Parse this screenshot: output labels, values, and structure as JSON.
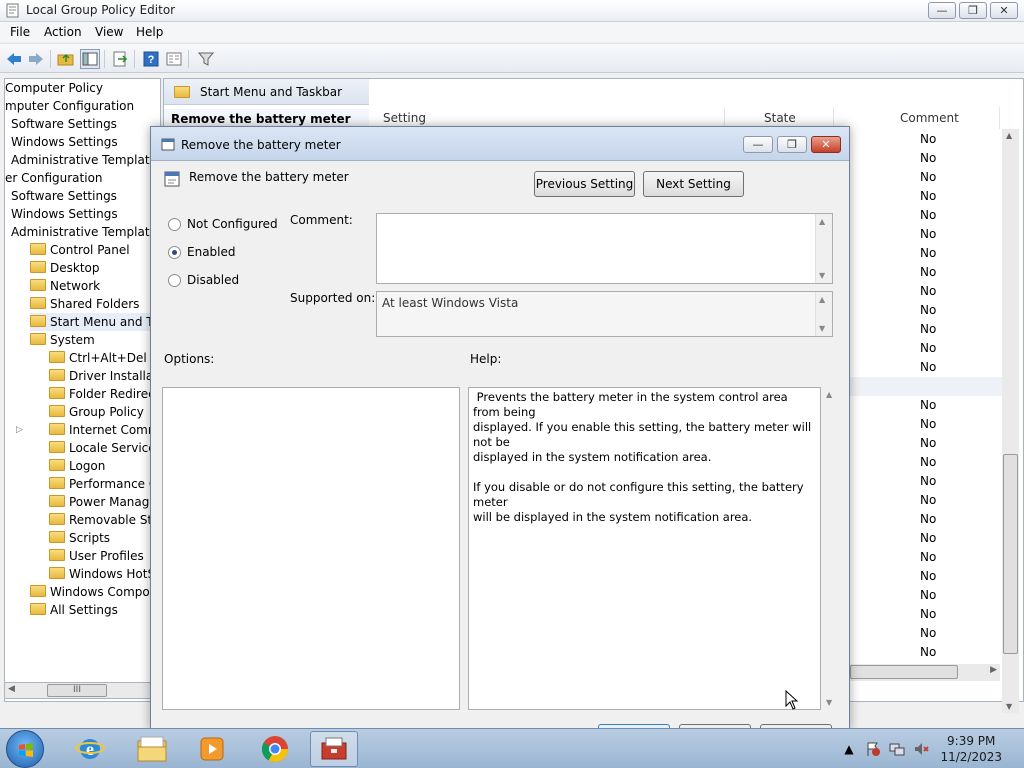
{
  "window": {
    "title": "Local Group Policy Editor",
    "min": "—",
    "max": "❐",
    "close": "✕"
  },
  "menu": [
    "File",
    "Action",
    "View",
    "Help"
  ],
  "tree": {
    "items": [
      {
        "label": "Computer Policy",
        "indent": 0,
        "folder": false
      },
      {
        "label": "mputer Configuration",
        "indent": 0,
        "folder": false
      },
      {
        "label": "Software Settings",
        "indent": 1,
        "folder": false
      },
      {
        "label": "Windows Settings",
        "indent": 1,
        "folder": false
      },
      {
        "label": "Administrative Templates",
        "indent": 1,
        "folder": false
      },
      {
        "label": "er Configuration",
        "indent": 0,
        "folder": false
      },
      {
        "label": "Software Settings",
        "indent": 1,
        "folder": false
      },
      {
        "label": "Windows Settings",
        "indent": 1,
        "folder": false
      },
      {
        "label": "Administrative Templates",
        "indent": 1,
        "folder": false
      },
      {
        "label": "Control Panel",
        "indent": 2,
        "folder": true
      },
      {
        "label": "Desktop",
        "indent": 2,
        "folder": true
      },
      {
        "label": "Network",
        "indent": 2,
        "folder": true
      },
      {
        "label": "Shared Folders",
        "indent": 2,
        "folder": true
      },
      {
        "label": "Start Menu and Taskba",
        "indent": 2,
        "folder": true,
        "selected": true
      },
      {
        "label": "System",
        "indent": 2,
        "folder": true
      },
      {
        "label": "Ctrl+Alt+Del Optio",
        "indent": 3,
        "folder": true
      },
      {
        "label": "Driver Installation",
        "indent": 3,
        "folder": true
      },
      {
        "label": "Folder Redirection",
        "indent": 3,
        "folder": true
      },
      {
        "label": "Group Policy",
        "indent": 3,
        "folder": true
      },
      {
        "label": "Internet Communi",
        "indent": 3,
        "folder": true,
        "expander": true
      },
      {
        "label": "Locale Services",
        "indent": 3,
        "folder": true
      },
      {
        "label": "Logon",
        "indent": 3,
        "folder": true
      },
      {
        "label": "Performance Contr",
        "indent": 3,
        "folder": true
      },
      {
        "label": "Power Managemen",
        "indent": 3,
        "folder": true
      },
      {
        "label": "Removable Storage",
        "indent": 3,
        "folder": true
      },
      {
        "label": "Scripts",
        "indent": 3,
        "folder": true
      },
      {
        "label": "User Profiles",
        "indent": 3,
        "folder": true
      },
      {
        "label": "Windows HotStart",
        "indent": 3,
        "folder": true
      },
      {
        "label": "Windows Components",
        "indent": 2,
        "folder": true
      },
      {
        "label": "All Settings",
        "indent": 2,
        "folder": true
      }
    ],
    "scroll_thumb": "III"
  },
  "right_pane": {
    "header": "Start Menu and Taskbar",
    "selected_row": "Remove the battery meter",
    "columns": {
      "setting": "Setting",
      "state": "State",
      "comment": "Comment"
    },
    "comment_values": [
      "No",
      "No",
      "No",
      "No",
      "No",
      "No",
      "No",
      "No",
      "No",
      "No",
      "No",
      "No",
      "No",
      "No",
      "No",
      "No",
      "No",
      "No",
      "No",
      "No",
      "No",
      "No",
      "No",
      "No",
      "No",
      "No",
      "No",
      "No"
    ]
  },
  "dialog": {
    "title": "Remove the battery meter",
    "setting_name": "Remove the battery meter",
    "prev_button": "Previous Setting",
    "next_button": "Next Setting",
    "radios": [
      {
        "label": "Not Configured",
        "checked": false
      },
      {
        "label": "Enabled",
        "checked": true
      },
      {
        "label": "Disabled",
        "checked": false
      }
    ],
    "comment_label": "Comment:",
    "comment_value": "",
    "supported_label": "Supported on:",
    "supported_value": "At least Windows Vista",
    "options_label": "Options:",
    "help_label": "Help:",
    "help_text": " Prevents the battery meter in the system control area from being\ndisplayed. If you enable this setting, the battery meter will not be\ndisplayed in the system notification area.\n\nIf you disable or do not configure this setting, the battery meter\nwill be displayed in the system notification area."
  },
  "taskbar": {
    "time": "9:39 PM",
    "date": "11/2/2023",
    "tray_expand": "▲"
  }
}
